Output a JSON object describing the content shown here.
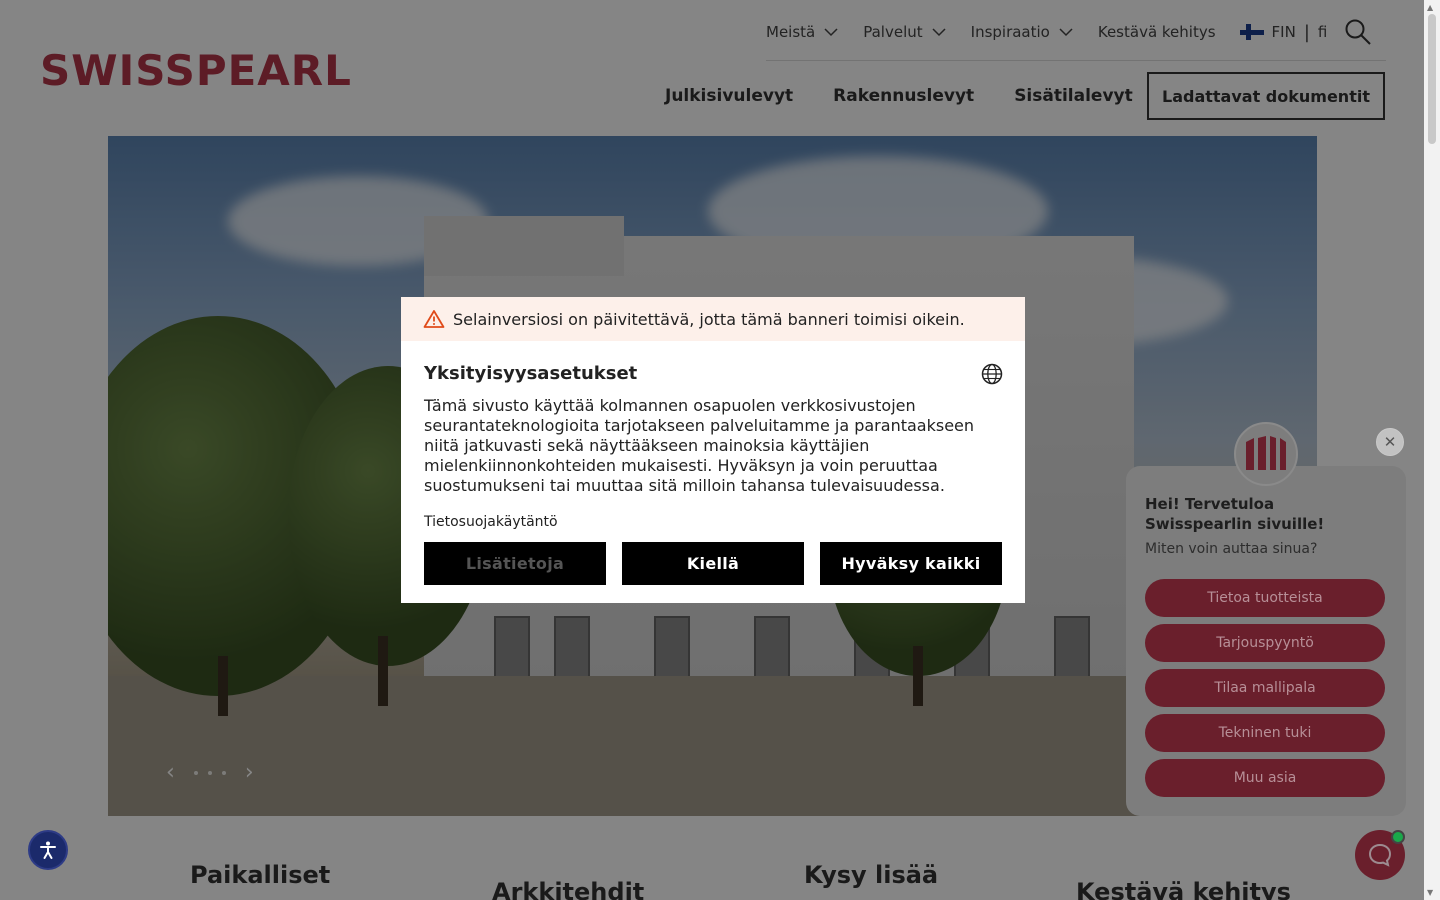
{
  "header": {
    "logo": "SWISSPEARL",
    "top_nav": [
      {
        "label": "Meistä",
        "dropdown": true
      },
      {
        "label": "Palvelut",
        "dropdown": true
      },
      {
        "label": "Inspiraatio",
        "dropdown": true
      },
      {
        "label": "Kestävä kehitys",
        "dropdown": false
      }
    ],
    "language": {
      "country": "FIN",
      "separator": "|",
      "code": "fi"
    },
    "main_nav": [
      "Julkisivulevyt",
      "Rakennuslevyt",
      "Sisätilalevyt"
    ],
    "docs_button": "Ladattavat dokumentit"
  },
  "hero": {
    "slides": 3
  },
  "sections": [
    "Paikalliset",
    "Arkkitehdit",
    "Kysy lisää",
    "Kestävä kehitys"
  ],
  "cookie_modal": {
    "warning": "Selainversiosi on päivitettävä, jotta tämä banneri toimisi oikein.",
    "title": "Yksityisyysasetukset",
    "text": "Tämä sivusto käyttää kolmannen osapuolen verkkosivustojen seurantateknologioita tarjotakseen palveluitamme ja parantaakseen niitä jatkuvasti sekä näyttääkseen mainoksia käyttäjien mielenkiinnonkohteiden mukaisesti. Hyväksyn ja voin peruuttaa suostumukseni tai muuttaa sitä milloin tahansa tulevaisuudessa.",
    "privacy_link": "Tietosuojakäytäntö",
    "buttons": {
      "more_info": "Lisätietoja",
      "deny": "Kiellä",
      "accept_all": "Hyväksy kaikki"
    }
  },
  "chat": {
    "greeting": "Hei! Tervetuloa Swisspearlin sivuille!",
    "question": "Miten voin auttaa sinua?",
    "options": [
      "Tietoa tuotteista",
      "Tarjouspyyntö",
      "Tilaa mallipala",
      "Tekninen tuki",
      "Muu asia"
    ]
  },
  "colors": {
    "brand": "#b2364a",
    "chat_button": "#6a1f2c",
    "online": "#1aa84a",
    "accessibility": "#1b2a6b"
  }
}
